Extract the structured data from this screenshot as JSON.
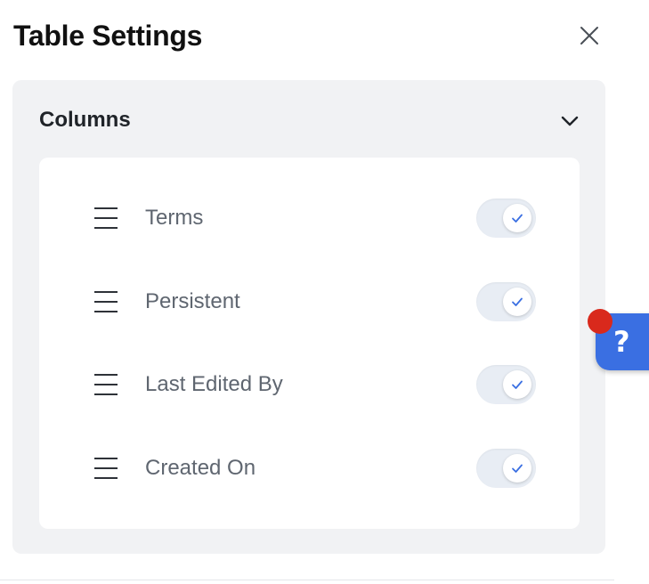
{
  "dialog": {
    "title": "Table Settings",
    "close_icon": "close-icon"
  },
  "columns_section": {
    "title": "Columns",
    "expanded": true,
    "toggle_icon": "chevron-down-icon",
    "items": [
      {
        "label": "Terms",
        "enabled": true
      },
      {
        "label": "Persistent",
        "enabled": true
      },
      {
        "label": "Last Edited By",
        "enabled": true
      },
      {
        "label": "Created On",
        "enabled": true
      }
    ]
  },
  "help_widget": {
    "glyph": "?",
    "has_notification": true
  },
  "colors": {
    "accent": "#3a6fe2",
    "notification": "#d9291c",
    "panel_background": "#f1f2f4",
    "toggle_check": "#3a6fe2"
  }
}
